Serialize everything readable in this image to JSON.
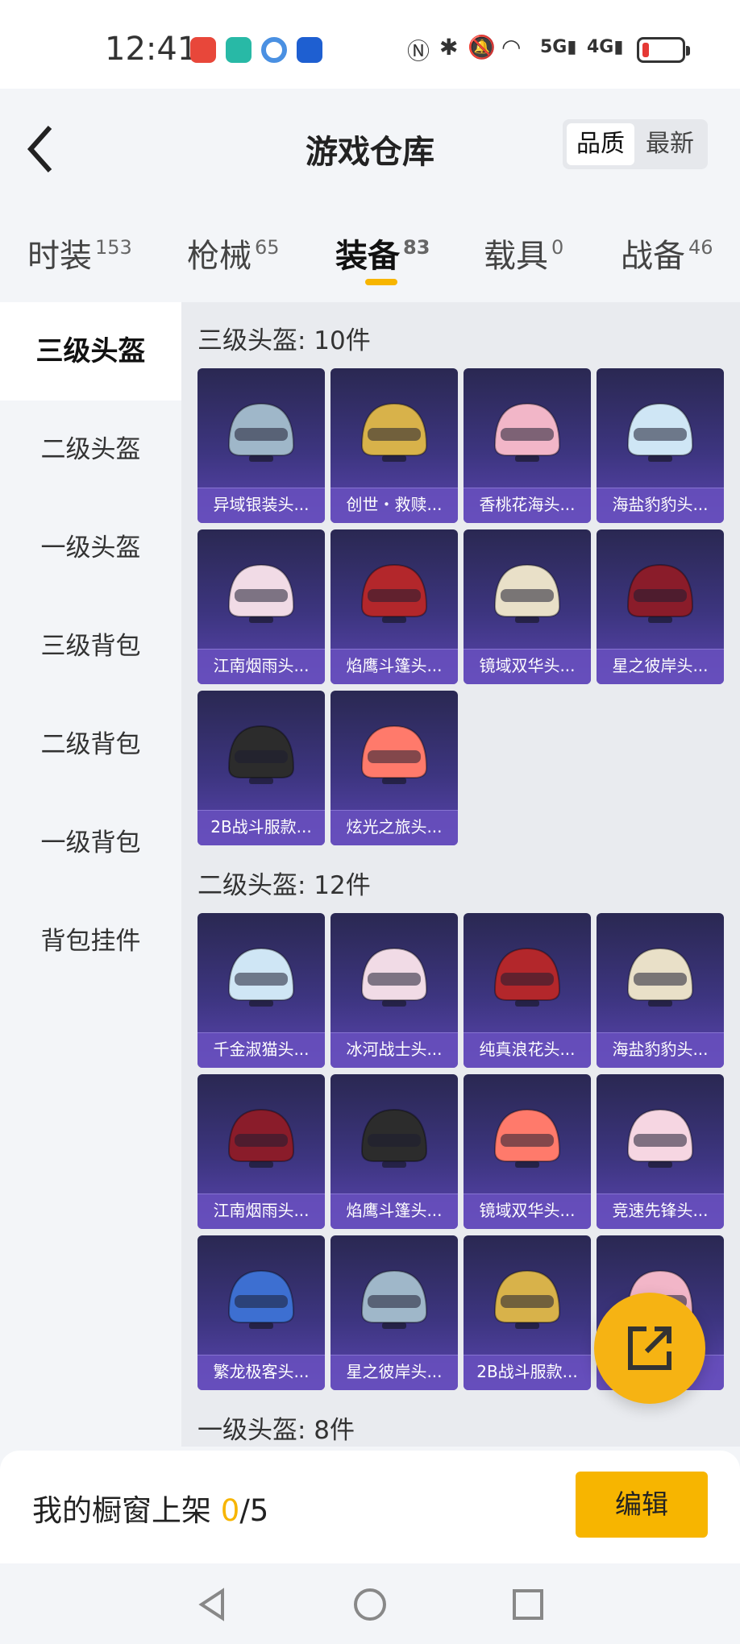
{
  "status": {
    "time": "12:41",
    "net_icons": [
      "N",
      "✱",
      "🔕",
      "📶",
      "5G",
      "4G"
    ]
  },
  "header": {
    "title": "游戏仓库",
    "sort_options": [
      "品质",
      "最新"
    ],
    "sort_active": "品质"
  },
  "tabs": [
    {
      "label": "时装",
      "count": "153"
    },
    {
      "label": "枪械",
      "count": "65"
    },
    {
      "label": "装备",
      "count": "83"
    },
    {
      "label": "载具",
      "count": "0"
    },
    {
      "label": "战备",
      "count": "46"
    }
  ],
  "active_tab": "装备",
  "sidebar": [
    "三级头盔",
    "二级头盔",
    "一级头盔",
    "三级背包",
    "二级背包",
    "一级背包",
    "背包挂件"
  ],
  "sidebar_active": "三级头盔",
  "sections": [
    {
      "title": "三级头盔: 10件",
      "items": [
        "异域银装头...",
        "创世・救赎...",
        "香桃花海头...",
        "海盐豹豹头...",
        "江南烟雨头...",
        "焰鹰斗篷头...",
        "镜域双华头...",
        "星之彼岸头...",
        "2B战斗服款...",
        "炫光之旅头..."
      ]
    },
    {
      "title": "二级头盔: 12件",
      "items": [
        "千金淑猫头...",
        "冰河战士头...",
        "纯真浪花头...",
        "海盐豹豹头...",
        "江南烟雨头...",
        "焰鹰斗篷头...",
        "镜域双华头...",
        "竞速先锋头...",
        "繁龙极客头...",
        "星之彼岸头...",
        "2B战斗服款...",
        "..."
      ]
    },
    {
      "title": "一级头盔: 8件",
      "items": []
    }
  ],
  "bottom": {
    "shelf_label": "我的橱窗上架 ",
    "shelf_count": "0",
    "shelf_total": "/5",
    "edit_label": "编辑"
  },
  "colors": {
    "accent": "#f7b500",
    "card_bg": "#3d3580"
  }
}
